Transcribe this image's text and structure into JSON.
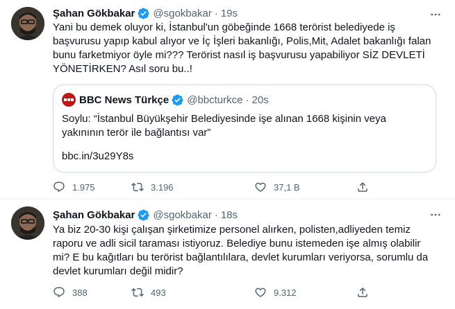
{
  "tweets": [
    {
      "author": {
        "name": "Şahan Gökbakar",
        "handle": "@sgokbakar"
      },
      "separator": "·",
      "time": "19s",
      "text": "Yani bu demek oluyor ki, İstanbul'un göbeğinde 1668 terörist belediyede iş\nbaşvurusu yapıp kabul alıyor ve  İç İşleri bakanlığı, Polis,Mit, Adalet bakanlığı falan\nbunu farketmiyor öyle mi??? Terörist nasıl iş başvurusu yapabiliyor SİZ DEVLETİ\nYÖNETİRKEN? Asıl soru bu..!",
      "quote": {
        "author": {
          "name": "BBC News Türkçe",
          "handle": "@bbcturkce"
        },
        "separator": "·",
        "time": "20s",
        "text": "Soylu: “İstanbul Büyükşehir Belediyesinde işe alınan 1668 kişinin veya\nyakınının terör ile bağlantısı var”",
        "link": "bbc.in/3u29Y8s"
      },
      "counts": {
        "reply": "1.975",
        "retweet": "3.196",
        "like": "37,1 B"
      }
    },
    {
      "author": {
        "name": "Şahan Gökbakar",
        "handle": "@sgokbakar"
      },
      "separator": "·",
      "time": "18s",
      "text": "Ya biz 20-30 kişi çalışan şirketimize personel alırken, polisten,adliyeden temiz\nraporu ve adli sicil taraması istiyoruz. Belediye bunu istemeden işe almış olabilir\nmi? E bu kağıtları bu terörist bağlantılılara, devlet kurumları veriyorsa, sorumlu da\ndevlet kurumları değil midir?",
      "counts": {
        "reply": "388",
        "retweet": "493",
        "like": "9.312"
      }
    }
  ],
  "colors": {
    "accent": "#1d9bf0",
    "secondary_text": "#536471",
    "border": "#cfd9de",
    "bbc_red": "#bb1919"
  },
  "icons": [
    "verified-badge-icon",
    "more-icon",
    "reply-icon",
    "retweet-icon",
    "like-icon",
    "share-icon"
  ]
}
